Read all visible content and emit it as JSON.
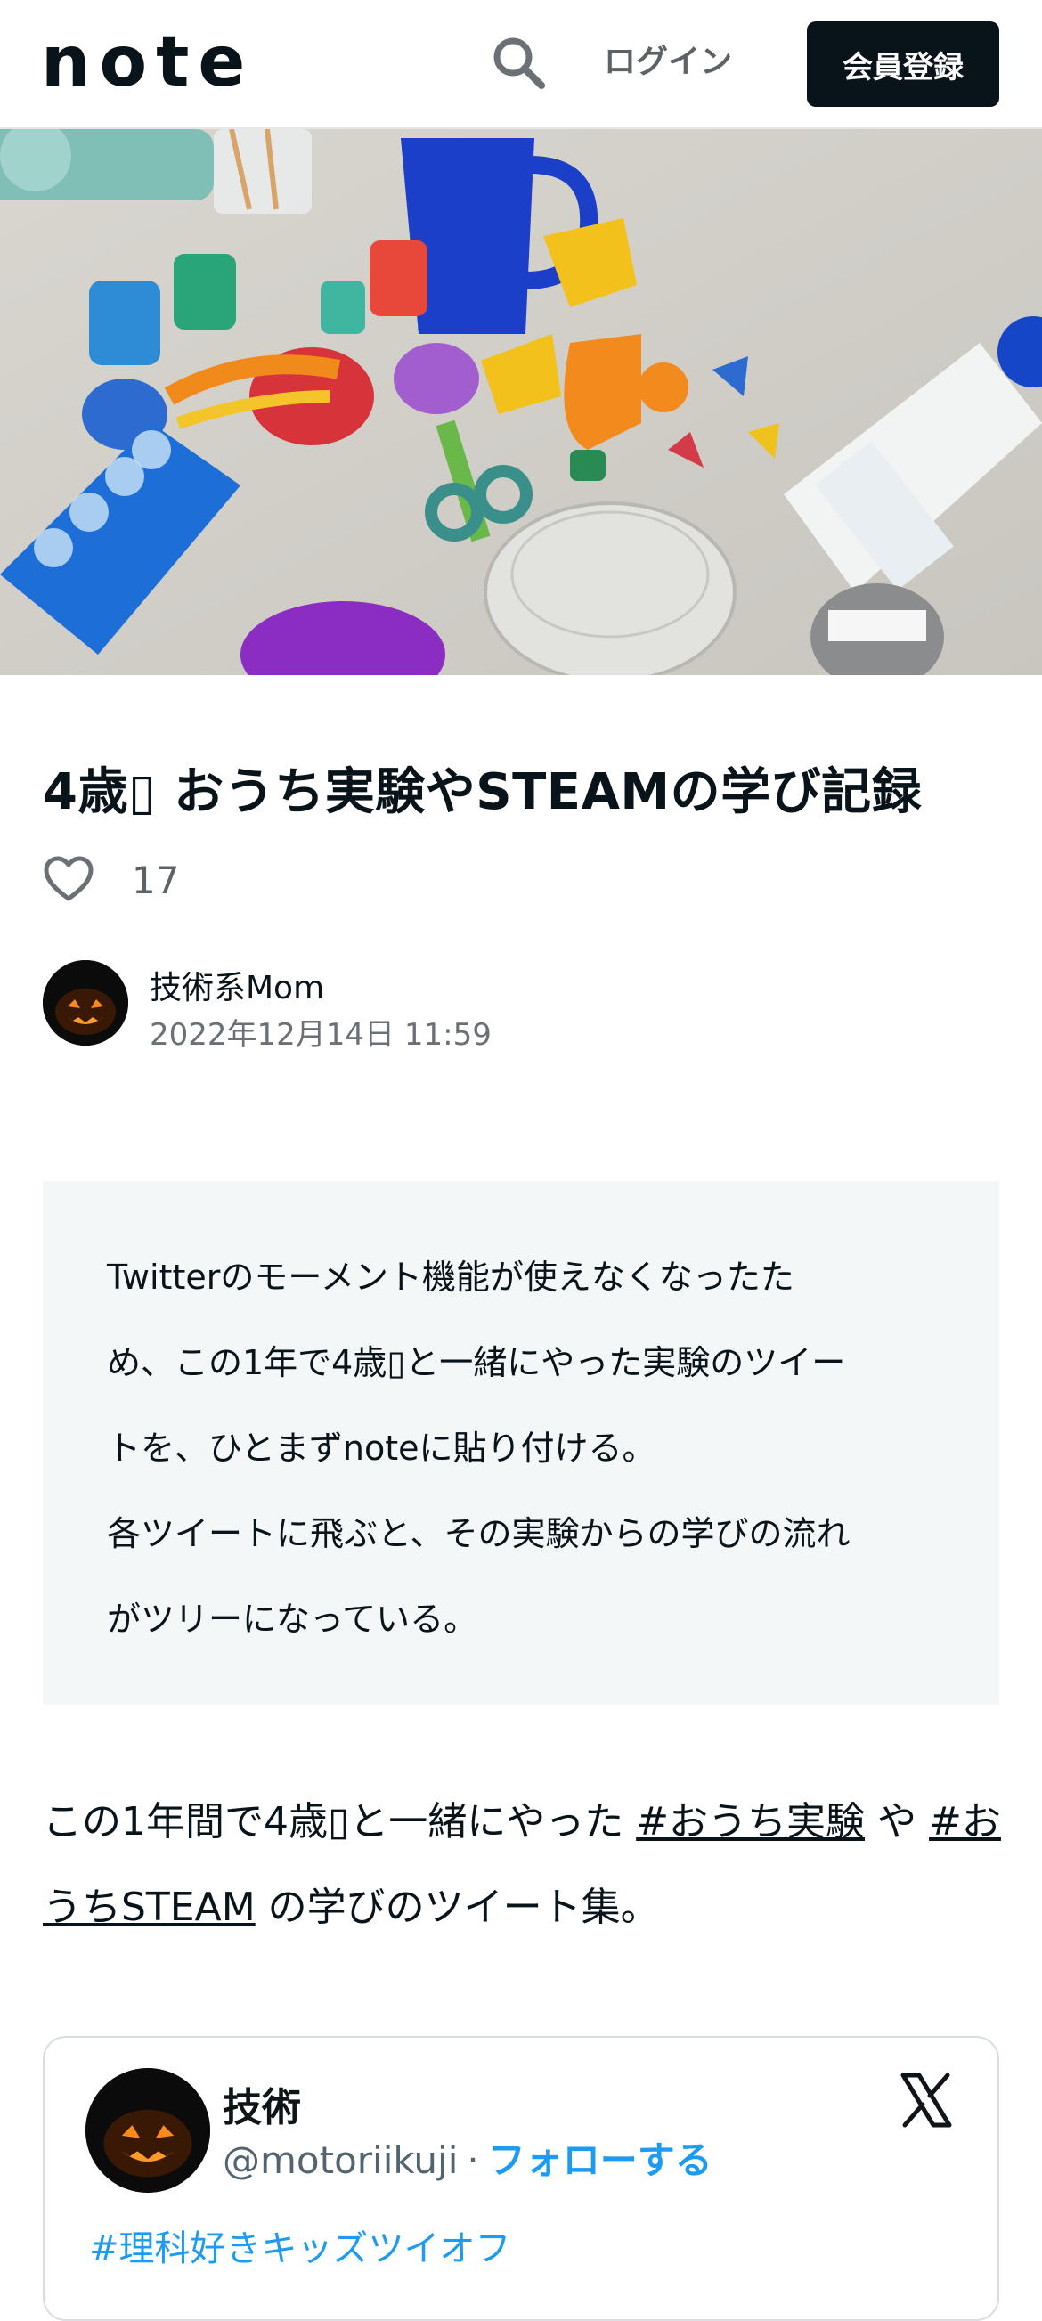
{
  "header": {
    "logo_text": "note",
    "search_icon": "search-icon",
    "login_label": "ログイン",
    "signup_label": "会員登録"
  },
  "hero": {
    "image_icon": "hero-photo"
  },
  "article": {
    "title": "4歳▯ おうち実験やSTEAMの学び記録",
    "like_count": "17",
    "author_name": "技術系Mom",
    "date": "2022年12月14日 11:59",
    "quote_lines": [
      "Twitterのモーメント機能が使えなくなったた",
      "め、この1年で4歳▯と一緒にやった実験のツイー",
      "トを、ひとまずnoteに貼り付ける。",
      "各ツイートに飛ぶと、その実験からの学びの流れ",
      "がツリーになっている。"
    ],
    "para_part1": "この1年間で4歳▯と一緒にやった ",
    "para_tag1": "#おうち実験",
    "para_part2": " や ",
    "para_tag2": "#おうちSTEAM",
    "para_part3": " の学びのツイート集。"
  },
  "tweet": {
    "name": "技術",
    "handle": "@motoriikuji",
    "separator": "·",
    "follow_label": "フォローする",
    "text": "#理科好きキッズツイオフ"
  },
  "colors": {
    "accent_dark": "#08131a",
    "twitter_blue": "#1d9bf0",
    "quote_bg": "#f3f7f8"
  }
}
